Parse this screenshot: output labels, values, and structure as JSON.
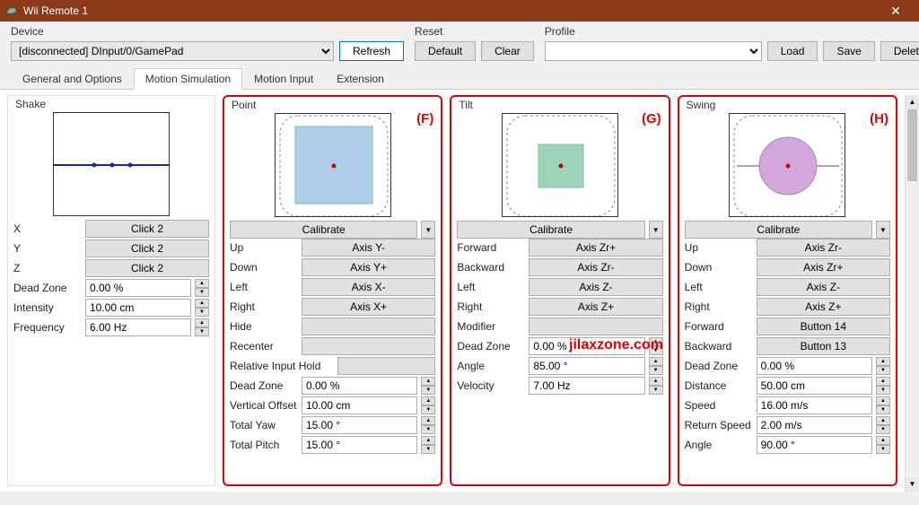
{
  "window": {
    "title": "Wii Remote 1"
  },
  "device": {
    "label": "Device",
    "selected": "[disconnected] DInput/0/GamePad",
    "refresh": "Refresh"
  },
  "reset": {
    "label": "Reset",
    "default": "Default",
    "clear": "Clear"
  },
  "profile": {
    "label": "Profile",
    "selected": "",
    "load": "Load",
    "save": "Save",
    "delete": "Delete"
  },
  "tabs": [
    "General and Options",
    "Motion Simulation",
    "Motion Input",
    "Extension"
  ],
  "active_tab": 1,
  "shake": {
    "title": "Shake",
    "rows": [
      {
        "lbl": "X",
        "val": "Click 2",
        "type": "btn"
      },
      {
        "lbl": "Y",
        "val": "Click 2",
        "type": "btn"
      },
      {
        "lbl": "Z",
        "val": "Click 2",
        "type": "btn"
      },
      {
        "lbl": "Dead Zone",
        "val": "0.00 %",
        "type": "num"
      },
      {
        "lbl": "Intensity",
        "val": "10.00 cm",
        "type": "num"
      },
      {
        "lbl": "Frequency",
        "val": "6.00 Hz",
        "type": "num"
      }
    ]
  },
  "point": {
    "title": "Point",
    "anno": "(F)",
    "calibrate": "Calibrate",
    "rows": [
      {
        "lbl": "Up",
        "val": "Axis Y-",
        "type": "btn"
      },
      {
        "lbl": "Down",
        "val": "Axis Y+",
        "type": "btn"
      },
      {
        "lbl": "Left",
        "val": "Axis X-",
        "type": "btn"
      },
      {
        "lbl": "Right",
        "val": "Axis X+",
        "type": "btn"
      },
      {
        "lbl": "Hide",
        "val": "",
        "type": "btn"
      },
      {
        "lbl": "Recenter",
        "val": "",
        "type": "btn"
      },
      {
        "lbl": "Relative Input Hold",
        "val": "",
        "type": "btn",
        "wide": true
      },
      {
        "lbl": "Dead Zone",
        "val": "0.00 %",
        "type": "num"
      },
      {
        "lbl": "Vertical Offset",
        "val": "10.00 cm",
        "type": "num"
      },
      {
        "lbl": "Total Yaw",
        "val": "15.00 °",
        "type": "num"
      },
      {
        "lbl": "Total Pitch",
        "val": "15.00 °",
        "type": "num"
      }
    ]
  },
  "tilt": {
    "title": "Tilt",
    "anno": "(G)",
    "calibrate": "Calibrate",
    "rows": [
      {
        "lbl": "Forward",
        "val": "Axis Zr+",
        "type": "btn"
      },
      {
        "lbl": "Backward",
        "val": "Axis Zr-",
        "type": "btn"
      },
      {
        "lbl": "Left",
        "val": "Axis Z-",
        "type": "btn"
      },
      {
        "lbl": "Right",
        "val": "Axis Z+",
        "type": "btn"
      },
      {
        "lbl": "Modifier",
        "val": "",
        "type": "btn"
      },
      {
        "lbl": "Dead Zone",
        "val": "0.00 %",
        "type": "num"
      },
      {
        "lbl": "Angle",
        "val": "85.00 °",
        "type": "num"
      },
      {
        "lbl": "Velocity",
        "val": "7.00 Hz",
        "type": "num"
      }
    ]
  },
  "swing": {
    "title": "Swing",
    "anno": "(H)",
    "calibrate": "Calibrate",
    "rows": [
      {
        "lbl": "Up",
        "val": "Axis Zr-",
        "type": "btn"
      },
      {
        "lbl": "Down",
        "val": "Axis Zr+",
        "type": "btn"
      },
      {
        "lbl": "Left",
        "val": "Axis Z-",
        "type": "btn"
      },
      {
        "lbl": "Right",
        "val": "Axis Z+",
        "type": "btn"
      },
      {
        "lbl": "Forward",
        "val": "Button 14",
        "type": "btn"
      },
      {
        "lbl": "Backward",
        "val": "Button 13",
        "type": "btn"
      },
      {
        "lbl": "Dead Zone",
        "val": "0.00 %",
        "type": "num"
      },
      {
        "lbl": "Distance",
        "val": "50.00 cm",
        "type": "num"
      },
      {
        "lbl": "Speed",
        "val": "16.00 m/s",
        "type": "num"
      },
      {
        "lbl": "Return Speed",
        "val": "2.00 m/s",
        "type": "num"
      },
      {
        "lbl": "Angle",
        "val": "90.00 °",
        "type": "num"
      }
    ]
  },
  "watermark": "jilaxzone.com"
}
